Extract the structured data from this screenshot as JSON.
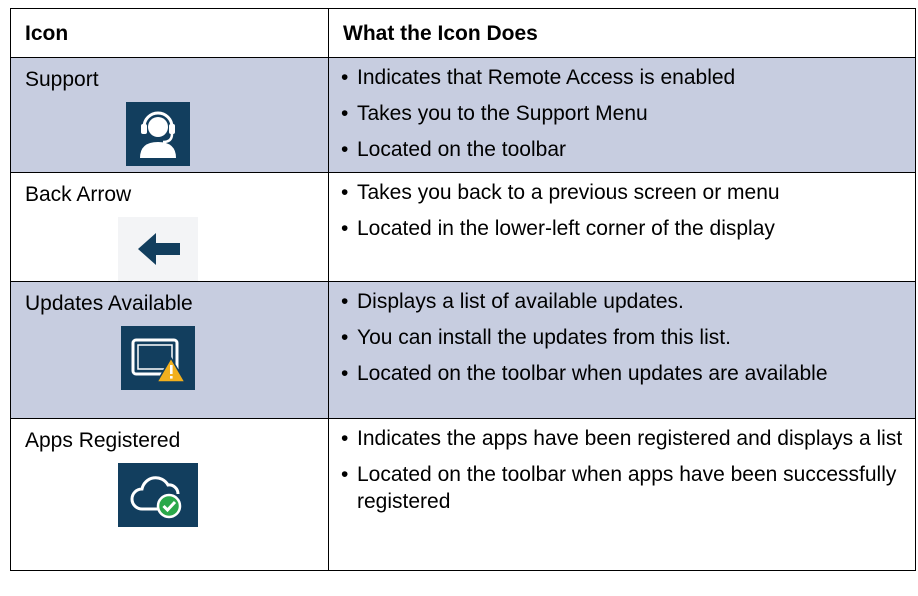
{
  "table": {
    "headers": [
      "Icon",
      "What the Icon Does"
    ],
    "rows": [
      {
        "name": "Support",
        "icon": "headset-support-icon",
        "bullets": [
          "Indicates that Remote Access is enabled",
          "Takes you to the Support Menu",
          "Located on the toolbar"
        ]
      },
      {
        "name": "Back Arrow",
        "icon": "back-arrow-icon",
        "bullets": [
          "Takes you back to a previous screen or menu",
          "Located in the lower-left corner of the display"
        ]
      },
      {
        "name": "Updates Available",
        "icon": "screen-warning-icon",
        "bullets": [
          "Displays a list of available updates.",
          "You can install the updates from this list.",
          "Located on the toolbar when updates are available"
        ]
      },
      {
        "name": "Apps Registered",
        "icon": "cloud-check-icon",
        "bullets": [
          "Indicates the apps have been registered and displays a list",
          "Located on the toolbar when apps have been successfully registered"
        ]
      }
    ]
  },
  "colors": {
    "row_shade": "#c7cde0",
    "icon_bg": "#123e5e",
    "warning": "#f2b01e",
    "check": "#2aa84a"
  }
}
